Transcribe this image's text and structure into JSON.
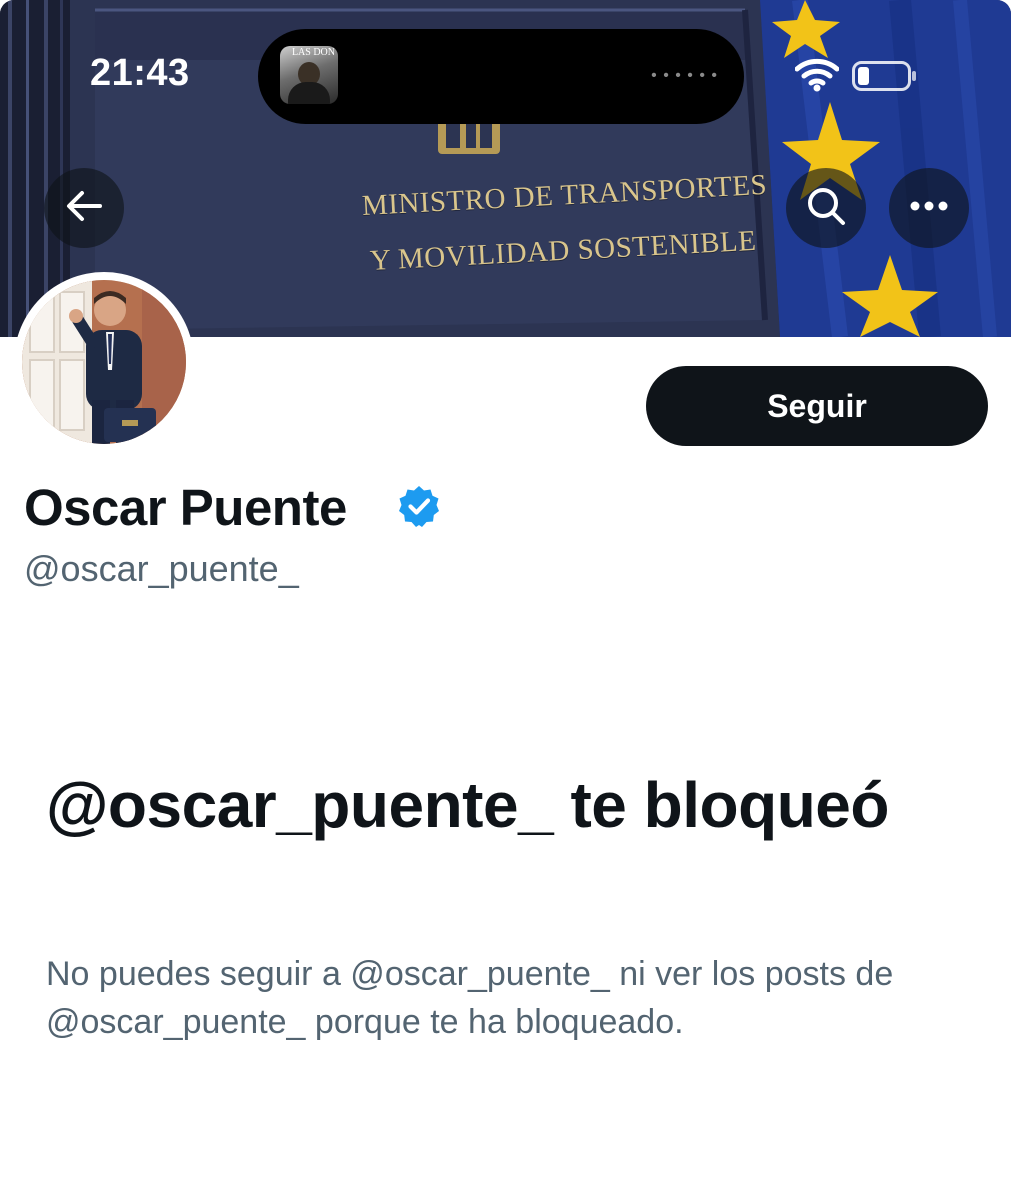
{
  "status_bar": {
    "time": "21:43",
    "now_playing_art_text": "LAS DON",
    "signal_icon": "wifi-icon",
    "battery_icon": "battery-icon"
  },
  "banner": {
    "line1": "MINISTRO DE TRANSPORTES",
    "line2": "Y MOVILIDAD SOSTENIBLE",
    "colors": {
      "navy": "#2b3350",
      "flag_blue": "#1f3a93",
      "star_gold": "#f2c318"
    }
  },
  "nav": {
    "back_icon": "arrow-left-icon",
    "search_icon": "search-icon",
    "more_icon": "more-horizontal-icon"
  },
  "profile": {
    "display_name": "Oscar Puente",
    "handle": "@oscar_puente_",
    "verified_icon": "verified-badge-icon",
    "follow_label": "Seguir"
  },
  "blocked": {
    "title": "@oscar_puente_ te bloqueó",
    "body": "No puedes seguir a @oscar_puente_ ni ver los posts de @oscar_puente_ porque te ha bloqueado."
  },
  "colors": {
    "text_primary": "#0f1419",
    "text_secondary": "#536471",
    "verified_blue": "#1d9bf0",
    "button_dark": "#0f1419"
  }
}
